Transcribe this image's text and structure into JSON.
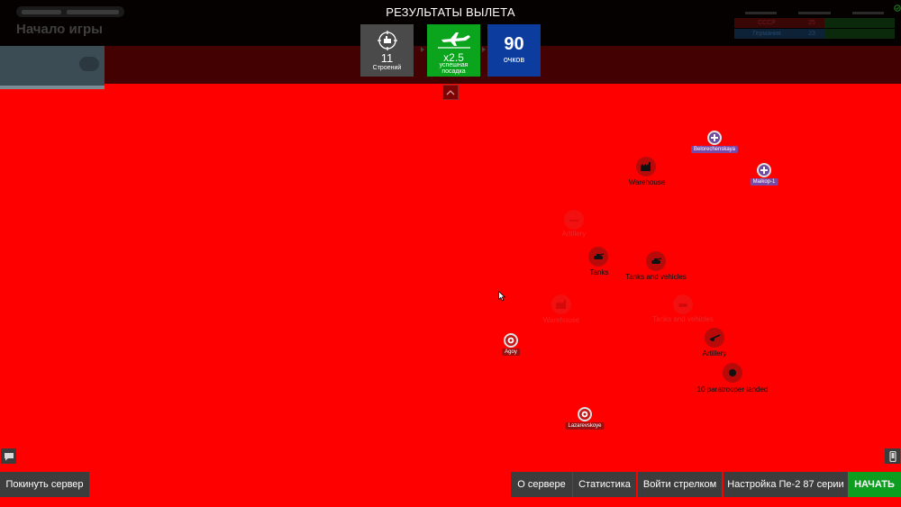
{
  "header": {
    "game_title": "Начало игры"
  },
  "results": {
    "title": "РЕЗУЛЬТАТЫ ВЫЛЕТА",
    "buildings": {
      "value": "11",
      "label": "Строений",
      "icon": "building-target-icon"
    },
    "landing": {
      "value": "x2.5",
      "label_line1": "успешная",
      "label_line2": "посадка",
      "icon": "plane-landing-icon"
    },
    "points": {
      "value": "90",
      "label": "очков"
    }
  },
  "scoreboard": {
    "rows": [
      {
        "team": "СССР",
        "score": "25",
        "color": "#3a0707"
      },
      {
        "team": "Германия",
        "score": "23",
        "color": "#0d2236"
      }
    ]
  },
  "map": {
    "markers": [
      {
        "id": "warehouse-active",
        "label": "Warehouse",
        "icon": "factory-icon",
        "state": "active"
      },
      {
        "id": "tanks",
        "label": "Tanks",
        "icon": "tank-icon",
        "state": "active"
      },
      {
        "id": "tanks-vehicles-active",
        "label": "Tanks and vehicles",
        "icon": "tank-icon",
        "state": "active"
      },
      {
        "id": "artillery",
        "label": "Artillery",
        "icon": "artillery-icon",
        "state": "active"
      },
      {
        "id": "paratrooper",
        "label": "10 paratrooper landed",
        "icon": "paratrooper-icon",
        "state": "active"
      },
      {
        "id": "faint-top",
        "label": "Artillery",
        "icon": "artillery-icon",
        "state": "destroyed"
      },
      {
        "id": "warehouse-faint",
        "label": "Warehouse",
        "icon": "factory-icon",
        "state": "destroyed"
      },
      {
        "id": "tanks-vehicles-faint",
        "label": "Tanks and vehicles",
        "icon": "tank-icon",
        "state": "destroyed"
      }
    ],
    "bases": [
      {
        "id": "belorechenskaya",
        "label": "Belorechenskaya",
        "side": "enemy"
      },
      {
        "id": "maikop",
        "label": "Maikop-1",
        "side": "enemy"
      },
      {
        "id": "agoy",
        "label": "Agoy",
        "side": "ally"
      },
      {
        "id": "lazarevskoye",
        "label": "Lazarevskoye",
        "side": "ally"
      }
    ]
  },
  "buttons": {
    "leave": "Покинуть сервер",
    "about": "О сервере",
    "stats": "Статистика",
    "gunner": "Войти стрелком",
    "setup": "Настройка Пе-2 87 серии",
    "start": "НАЧАТЬ"
  },
  "colors": {
    "map_red": "#fe0000",
    "start_green": "#0d9e1f",
    "points_blue": "#0c3d9e",
    "landing_green": "#0ba51d"
  }
}
